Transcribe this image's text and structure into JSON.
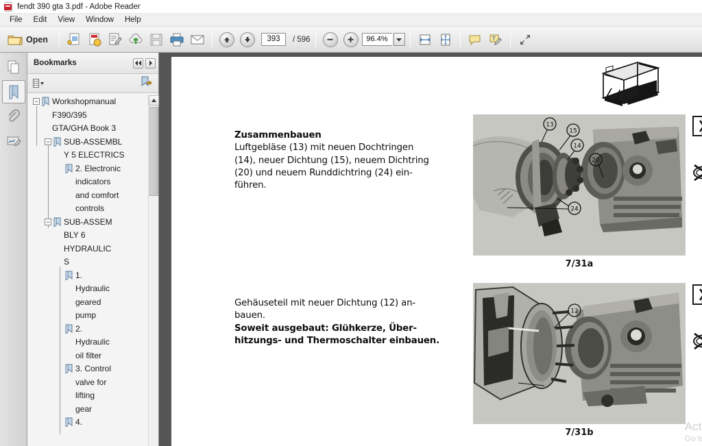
{
  "window": {
    "title": "fendt 390 gta 3.pdf - Adobe Reader",
    "app_icon": "pdf-document-icon"
  },
  "menu": {
    "items": [
      {
        "label": "File"
      },
      {
        "label": "Edit"
      },
      {
        "label": "View"
      },
      {
        "label": "Window"
      },
      {
        "label": "Help"
      }
    ]
  },
  "toolbar": {
    "open_label": "Open",
    "open_icon": "open-folder-icon",
    "tools": [
      {
        "name": "create-pdf-icon"
      },
      {
        "name": "combine-files-icon"
      },
      {
        "name": "edit-pdf-icon"
      },
      {
        "name": "send-to-cloud-icon"
      },
      {
        "name": "save-file-icon"
      },
      {
        "name": "print-icon"
      },
      {
        "name": "email-icon"
      }
    ],
    "previous_page_icon": "arrow-up-icon",
    "next_page_icon": "arrow-down-icon",
    "page_number": "393",
    "page_total": "/ 596",
    "zoom_out_icon": "minus-circle-icon",
    "zoom_in_icon": "plus-circle-icon",
    "zoom_level": "96.4%",
    "zoom_dropdown_icon": "chevron-down-icon",
    "fit_width_icon": "fit-width-icon",
    "fit_page_icon": "fit-page-icon",
    "comment_icon": "sticky-note-icon",
    "highlight_icon": "highlight-text-icon",
    "fullscreen_icon": "expand-arrows-icon"
  },
  "rail": {
    "items": [
      {
        "name": "page-thumbnails-icon",
        "active": false
      },
      {
        "name": "bookmarks-icon",
        "active": true
      },
      {
        "name": "attachments-paperclip-icon",
        "active": false
      },
      {
        "name": "signatures-icon",
        "active": false
      }
    ]
  },
  "bookmarks_panel": {
    "title": "Bookmarks",
    "collapse_icon": "double-chevron-left-icon",
    "expand_icon": "chevron-right-icon",
    "options_icon": "options-list-icon",
    "options_caret_icon": "caret-down-icon",
    "new_bookmark_icon": "new-bookmark-icon",
    "scroll_up_icon": "scroll-arrow-up-icon",
    "tree": [
      {
        "label": "Workshopmanual F390/395\nGTA/GHA Book 3",
        "depth": 0,
        "expanded": true,
        "has_children": true
      },
      {
        "label": "SUB-ASSEMBL\nY 5 ELECTRICS",
        "depth": 1,
        "expanded": true,
        "has_children": true
      },
      {
        "label": "2. Electronic\nindicators\nand comfort\ncontrols",
        "depth": 2,
        "expanded": false,
        "has_children": false
      },
      {
        "label": "SUB-ASSEM\nBLY 6\nHYDRAULIC\nS",
        "depth": 1,
        "expanded": true,
        "has_children": true
      },
      {
        "label": "1.\nHydraulic\ngeared\npump",
        "depth": 2,
        "expanded": false,
        "has_children": false
      },
      {
        "label": "2.\nHydraulic\noil filter",
        "depth": 2,
        "expanded": false,
        "has_children": false
      },
      {
        "label": "3. Control\nvalve for\nlifting\ngear",
        "depth": 2,
        "expanded": false,
        "has_children": false
      },
      {
        "label": "4.",
        "depth": 2,
        "expanded": false,
        "has_children": false
      }
    ]
  },
  "document": {
    "top_illustration": "tractor-cab-frame-drawing",
    "sections": [
      {
        "heading": "Zusammenbauen",
        "body": "Luftgebläse (13) mit neuen Dochtringen\n(14), neuer Dichtung (15), neuem Dichtring\n(20) und neuem Runddichtring (24) ein-\nführen.",
        "figure_caption": "7/31a",
        "figure_callouts": [
          "13",
          "15",
          "14",
          "20",
          "24"
        ],
        "symbols": [
          {
            "name": "press-together-arrows-symbol"
          },
          {
            "name": "do-not-lubricate-symbol"
          }
        ]
      },
      {
        "heading": "",
        "line1": "Gehäuseteil mit neuer Dichtung (12) an-\nbauen.",
        "line2": "Soweit ausgebaut: Glühkerze, Über-\nhitzungs- und Thermoschalter einbauen.",
        "figure_caption": "7/31b",
        "figure_callouts": [
          "12"
        ],
        "symbols": [
          {
            "name": "press-together-arrows-symbol"
          },
          {
            "name": "do-not-lubricate-symbol"
          }
        ]
      }
    ]
  },
  "watermark": {
    "line1": "Act",
    "line2": "Go to"
  },
  "colors": {
    "accent_red": "#c8202a",
    "doc_background": "#555555",
    "toolbar_bg": "#eaeaea",
    "panel_bg": "#f1f1f1"
  }
}
